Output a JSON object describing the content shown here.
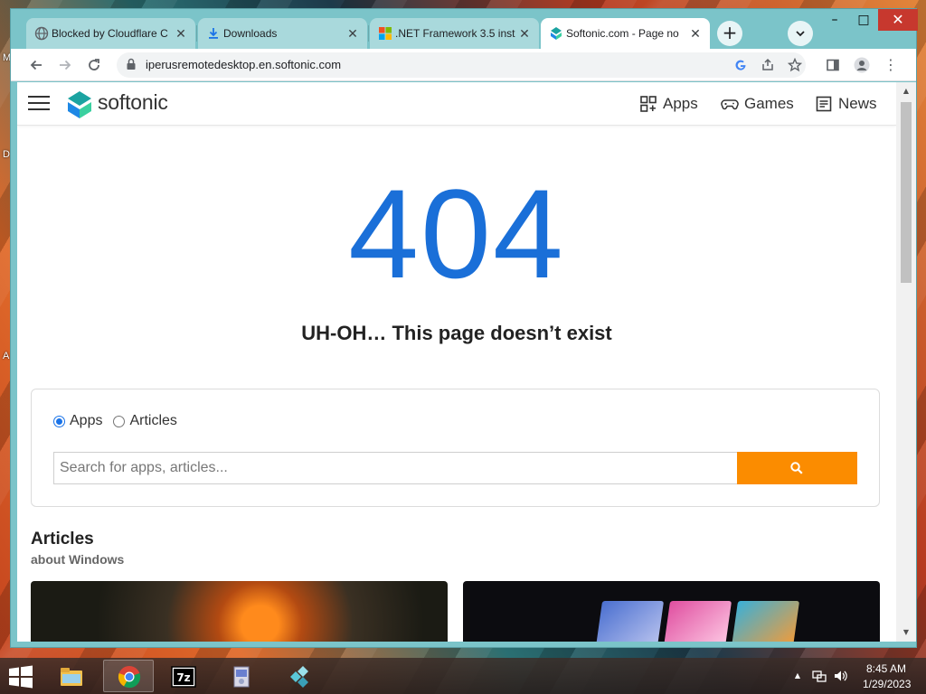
{
  "desktop": {
    "side_letters": [
      "M",
      "D",
      "A"
    ]
  },
  "browser": {
    "tabs": [
      {
        "title": "Blocked by Cloudflare C",
        "icon": "globe-icon",
        "active": false
      },
      {
        "title": "Downloads",
        "icon": "download-icon",
        "active": false
      },
      {
        "title": ".NET Framework 3.5 inst",
        "icon": "microsoft-icon",
        "active": false
      },
      {
        "title": "Softonic.com - Page no",
        "icon": "softonic-icon",
        "active": true
      }
    ],
    "close_glyph": "✕",
    "new_tab_glyph": "+",
    "tab_search_glyph": "⌄",
    "window_controls": {
      "minimize": "–",
      "maximize": "□",
      "close": "✕"
    },
    "toolbar": {
      "back_glyph": "←",
      "forward_glyph": "→",
      "reload_glyph": "↻",
      "url": "iperusremotedesktop.en.softonic.com",
      "omni_icons": [
        "google-icon",
        "share-icon",
        "star-icon"
      ],
      "side_panel_glyph": "▯",
      "profile_glyph": "●",
      "menu_glyph": "⋮"
    }
  },
  "site": {
    "brand": "softonic",
    "brand_colors": [
      "#1ba3a1",
      "#1e88e5",
      "#3ad0a0"
    ],
    "nav": [
      {
        "label": "Apps",
        "icon": "apps-grid-icon"
      },
      {
        "label": "Games",
        "icon": "gamepad-icon"
      },
      {
        "label": "News",
        "icon": "news-icon"
      }
    ],
    "error_code": "404",
    "error_color": "#1a6fd8",
    "headline": "UH-OH… This page doesn’t exist",
    "search": {
      "radio_options": [
        {
          "label": "Apps",
          "checked": true
        },
        {
          "label": "Articles",
          "checked": false
        }
      ],
      "placeholder": "Search for apps, articles...",
      "button_color": "#fb8c00"
    },
    "articles": {
      "title": "Articles",
      "subtitle": "about Windows"
    }
  },
  "taskbar": {
    "apps": [
      "file-explorer-icon",
      "chrome-icon",
      "7zip-icon",
      "installer-icon",
      "blocks-app-icon"
    ],
    "time": "8:45 AM",
    "date": "1/29/2023",
    "tray_glyphs": {
      "expand": "▲",
      "network": "⊡",
      "volume": "◀)"
    }
  }
}
